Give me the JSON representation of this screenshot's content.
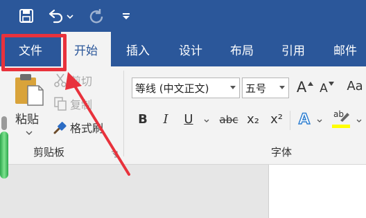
{
  "quick_access": {
    "save_icon": "save-icon",
    "undo_icon": "undo-icon",
    "redo_icon": "redo-icon",
    "customize_icon": "customize-qat-icon"
  },
  "tabs": [
    {
      "label": "文件"
    },
    {
      "label": "开始"
    },
    {
      "label": "插入"
    },
    {
      "label": "设计"
    },
    {
      "label": "布局"
    },
    {
      "label": "引用"
    },
    {
      "label": "邮件"
    }
  ],
  "clipboard": {
    "paste_label": "粘贴",
    "cut_label": "剪切",
    "copy_label": "复制",
    "format_painter_label": "格式刷",
    "group_label": "剪贴板"
  },
  "font": {
    "font_name": "等线 (中文正文)",
    "font_size": "五号",
    "group_label": "字体",
    "grow_label": "A",
    "shrink_label": "A",
    "case_label": "Aa",
    "bold_label": "B",
    "italic_label": "I",
    "underline_label": "U",
    "strike_label": "abc",
    "subscript_label": "x₂",
    "superscript_label": "x²",
    "effects_label": "A",
    "highlight_label": "ab"
  },
  "colors": {
    "accent": "#2b579a",
    "annotation": "#e8323c",
    "highlight_yellow": "#ffff00"
  }
}
